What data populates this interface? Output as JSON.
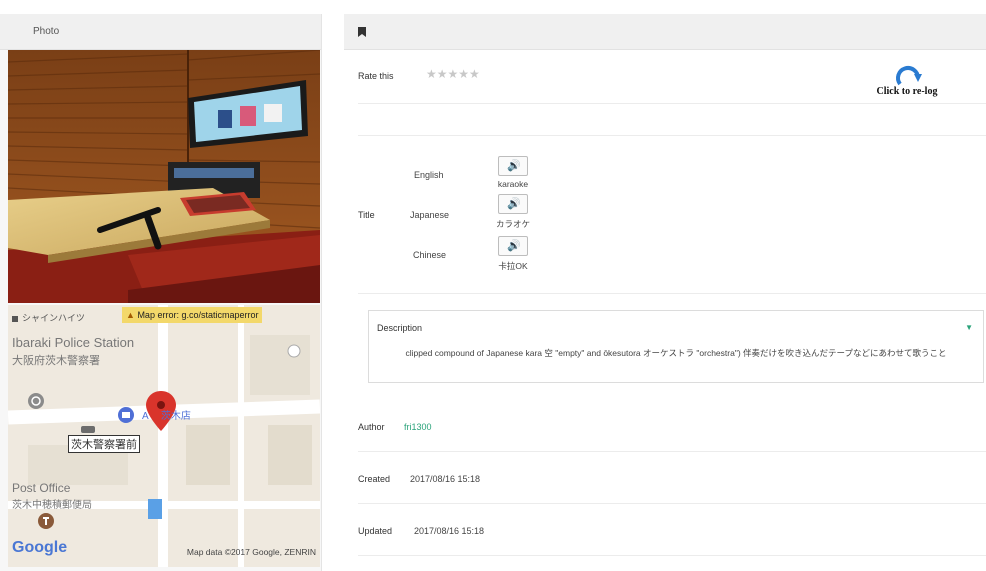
{
  "left": {
    "header": "Photo",
    "map": {
      "top_label": "シャインハイツ",
      "error_text": "Map error: g.co/staticmaperror",
      "station_en": "Ibaraki Police Station",
      "station_jp": "大阪府茨木警察署",
      "shop_label": "茨木店",
      "shop_prefix": "A",
      "bus_stop": "茨木警察署前",
      "post_en": "Post Office",
      "post_jp": "茨木中穂積郵便局",
      "google": "Google",
      "attribution": "Map data ©2017 Google, ZENRIN"
    }
  },
  "right": {
    "rate_label": "Rate this",
    "stars": "★★★★★",
    "relog_label": "Click to re-log",
    "title_label": "Title",
    "titles": [
      {
        "lang": "English",
        "word": "karaoke"
      },
      {
        "lang": "Japanese",
        "word": "カラオケ"
      },
      {
        "lang": "Chinese",
        "word": "卡拉OK"
      }
    ],
    "description": {
      "title": "Description",
      "text": "clipped compound of Japanese kara 空 \"empty\" and ōkesutora オーケストラ \"orchestra\") 伴奏だけを吹き込んだテープなどにあわせて歌うこと"
    },
    "author_label": "Author",
    "author_value": "fri1300",
    "created_label": "Created",
    "created_value": "2017/08/16 15:18",
    "updated_label": "Updated",
    "updated_value": "2017/08/16 15:18"
  },
  "colors": {
    "accent": "#2aa37a",
    "relog_blue": "#2a7bd1",
    "pin": "#d9342b"
  }
}
